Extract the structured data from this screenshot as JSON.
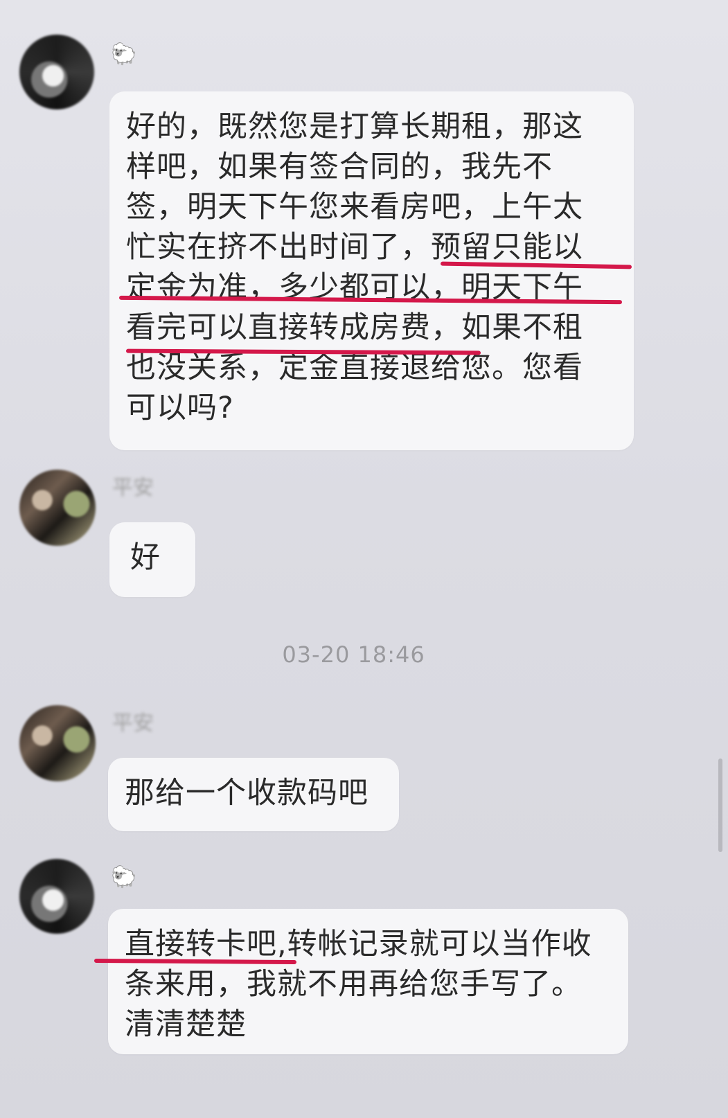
{
  "messages": [
    {
      "sender": "🐑",
      "text": "好的，既然您是打算长期租，那这\n样吧，如果有签合同的，我先不\n签，明天下午您来看房吧，上午太\n忙实在挤不出时间了，预留只能以\n定金为准，多少都可以，明天下午\n看完可以直接转成房费，如果不租\n也没关系，定金直接退给您。您看\n可以吗?"
    },
    {
      "sender": "平安",
      "text": "好"
    },
    {
      "sender": "平安",
      "text": "那给一个收款码吧"
    },
    {
      "sender": "🐑",
      "text": "直接转卡吧,转帐记录就可以当作收\n条来用，我就不用再给您手写了。\n清清楚楚"
    }
  ],
  "timestamp": "03-20 18:46",
  "colors": {
    "highlight_underline": "#d4184a",
    "bubble": "#f6f6f8",
    "background": "#dedee5"
  },
  "icons": {
    "avatar_1": "avatar-icon",
    "avatar_2": "avatar-icon"
  }
}
